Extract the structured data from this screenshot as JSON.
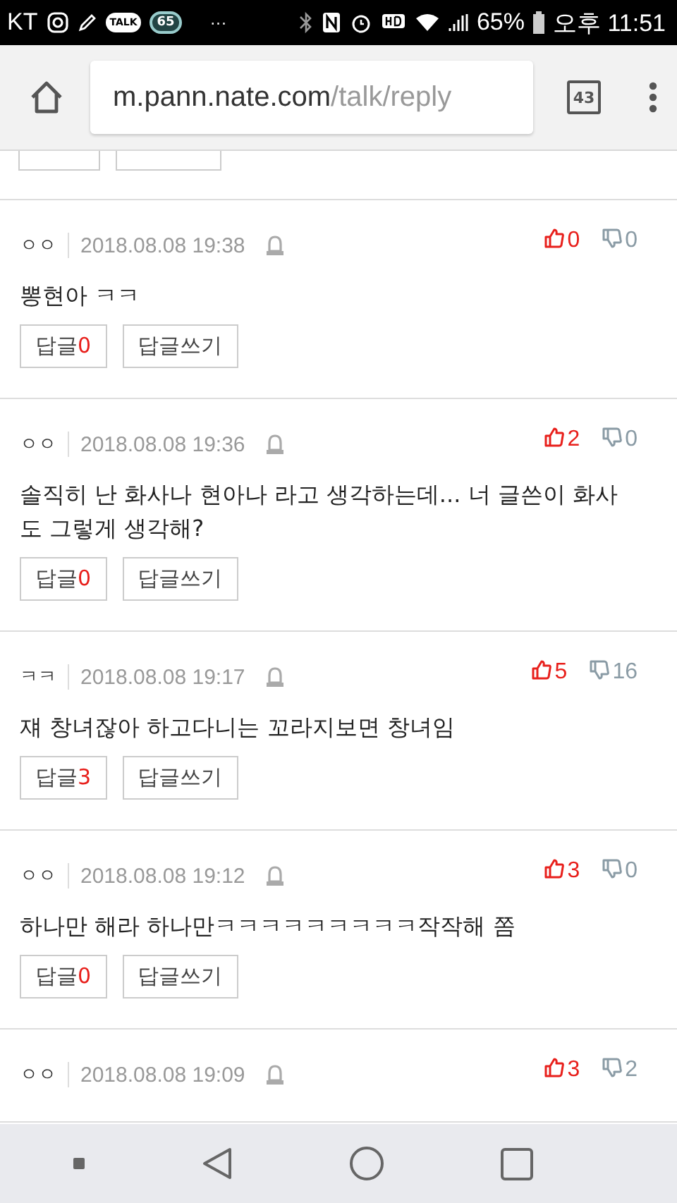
{
  "status_bar": {
    "carrier": "KT",
    "talk_badge": "TALK",
    "count_badge": "65",
    "more": "···",
    "battery": "65%",
    "time": "오후 11:51"
  },
  "browser": {
    "url_host": "m.pann.nate.com",
    "url_path": "/talk/reply",
    "tab_count": "43"
  },
  "comments": [
    {
      "author": "ㅇㅇ",
      "date": "2018.08.08 19:38",
      "body": "뽕현아 ㅋㅋ",
      "likes": "0",
      "dislikes": "0",
      "reply_label": "답글",
      "reply_count": "0",
      "write_label": "답글쓰기"
    },
    {
      "author": "ㅇㅇ",
      "date": "2018.08.08 19:36",
      "body": "솔직히 난 화사나 현아나 라고 생각하는데... 너 글쓴이 화사도 그렇게 생각해?",
      "likes": "2",
      "dislikes": "0",
      "reply_label": "답글",
      "reply_count": "0",
      "write_label": "답글쓰기"
    },
    {
      "author": "ㅋㅋ",
      "date": "2018.08.08 19:17",
      "body": "쟤 창녀잖아 하고다니는 꼬라지보면 창녀임",
      "likes": "5",
      "dislikes": "16",
      "reply_label": "답글",
      "reply_count": "3",
      "write_label": "답글쓰기"
    },
    {
      "author": "ㅇㅇ",
      "date": "2018.08.08 19:12",
      "body": "하나만 해라 하나만ㅋㅋㅋㅋㅋㅋㅋㅋㅋ작작해 쫌",
      "likes": "3",
      "dislikes": "0",
      "reply_label": "답글",
      "reply_count": "0",
      "write_label": "답글쓰기"
    },
    {
      "author": "ㅇㅇ",
      "date": "2018.08.08 19:09",
      "likes": "3",
      "dislikes": "2"
    }
  ]
}
